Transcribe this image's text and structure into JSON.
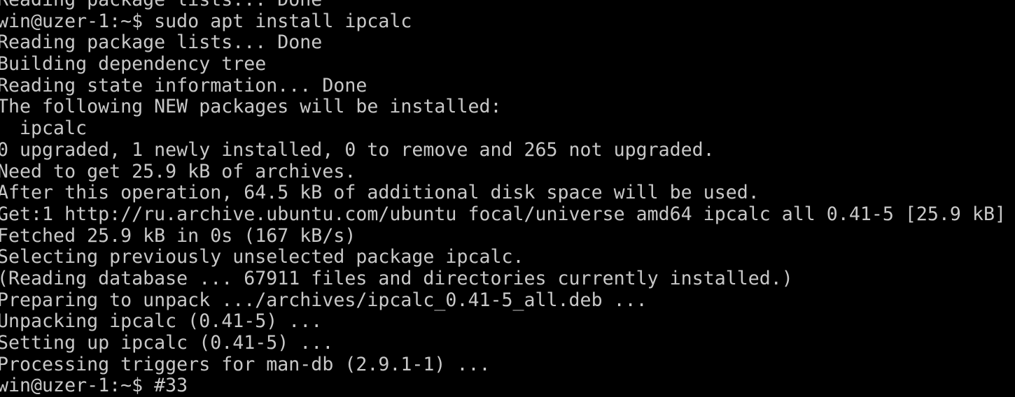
{
  "terminal": {
    "colors": {
      "background": "#000000",
      "foreground": "#c8c8c8"
    },
    "lines": [
      "Reading package lists... Done",
      "win@uzer-1:~$ sudo apt install ipcalc",
      "Reading package lists... Done",
      "Building dependency tree",
      "Reading state information... Done",
      "The following NEW packages will be installed:",
      "  ipcalc",
      "0 upgraded, 1 newly installed, 0 to remove and 265 not upgraded.",
      "Need to get 25.9 kB of archives.",
      "After this operation, 64.5 kB of additional disk space will be used.",
      "Get:1 http://ru.archive.ubuntu.com/ubuntu focal/universe amd64 ipcalc all 0.41-5 [25.9 kB]",
      "Fetched 25.9 kB in 0s (167 kB/s)",
      "Selecting previously unselected package ipcalc.",
      "(Reading database ... 67911 files and directories currently installed.)",
      "Preparing to unpack .../archives/ipcalc_0.41-5_all.deb ...",
      "Unpacking ipcalc (0.41-5) ...",
      "Setting up ipcalc (0.41-5) ...",
      "Processing triggers for man-db (2.9.1-1) ...",
      "win@uzer-1:~$ #33"
    ]
  }
}
